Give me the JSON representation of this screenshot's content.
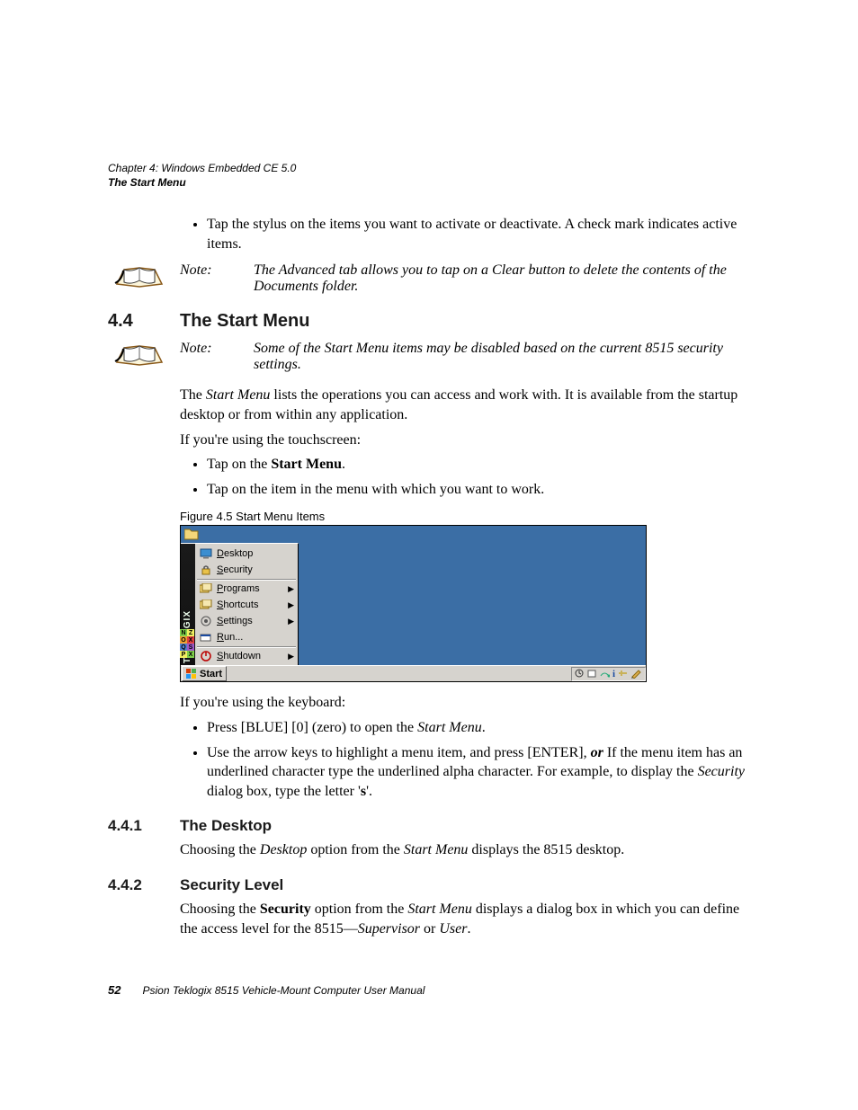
{
  "header": {
    "chapter": "Chapter 4: Windows Embedded CE 5.0",
    "section": "The Start Menu"
  },
  "intro_bullet": "Tap the stylus on the items you want to activate or deactivate. A check mark indicates active items.",
  "note1": {
    "label": "Note:",
    "text": "The Advanced tab allows you to tap on a Clear button to delete the contents of the Documents folder."
  },
  "sec44": {
    "num": "4.4",
    "title": "The Start Menu"
  },
  "note2": {
    "label": "Note:",
    "text": "Some of the Start Menu items may be disabled based on the current 8515 security settings."
  },
  "para1_a": "The ",
  "para1_i": "Start Menu",
  "para1_b": " lists the operations you can access and work with. It is available from the startup desktop or from within any application.",
  "para2": "If you're using the touchscreen:",
  "ts_bullets": {
    "b1_a": "Tap on the ",
    "b1_bold": "Start Menu",
    "b1_b": ".",
    "b2": "Tap on the item in the menu with which you want to work."
  },
  "fig_caption": "Figure 4.5  Start Menu Items",
  "menu": {
    "side": "TEKLOGIX",
    "items": [
      {
        "label": "Desktop",
        "arrow": false
      },
      {
        "label": "Security",
        "arrow": false
      },
      {
        "label": "Programs",
        "arrow": true
      },
      {
        "label": "Shortcuts",
        "arrow": true
      },
      {
        "label": "Settings",
        "arrow": true
      },
      {
        "label": "Run...",
        "arrow": false
      },
      {
        "label": "Shutdown",
        "arrow": true
      }
    ],
    "start": "Start"
  },
  "para3": "If you're using the keyboard:",
  "kb_bullets": {
    "b1_a": "Press [BLUE] [0] (zero) to open the ",
    "b1_i": "Start Menu",
    "b1_b": ".",
    "b2_a": "Use the arrow keys to highlight a menu item, and press [ENTER], ",
    "b2_or": "or",
    "b2_b": " If the menu item has an underlined character type the underlined alpha character. For example, to display the ",
    "b2_i": "Security",
    "b2_c": " dialog box, type the letter '",
    "b2_bold": "s",
    "b2_d": "'."
  },
  "sec441": {
    "num": "4.4.1",
    "title": "The Desktop"
  },
  "para441_a": "Choosing the ",
  "para441_i1": "Desktop",
  "para441_b": " option from the ",
  "para441_i2": "Start Menu",
  "para441_c": " displays the 8515 desktop.",
  "sec442": {
    "num": "4.4.2",
    "title": "Security Level"
  },
  "para442_a": "Choosing the ",
  "para442_bold": "Security",
  "para442_b": " option from the ",
  "para442_i1": "Start Menu",
  "para442_c": " displays a dialog box in which you can define the access level for the 8515—",
  "para442_i2": "Supervisor",
  "para442_d": " or ",
  "para442_i3": "User",
  "para442_e": ".",
  "footer": {
    "page": "52",
    "text": "Psion Teklogix 8515 Vehicle-Mount Computer User Manual"
  }
}
